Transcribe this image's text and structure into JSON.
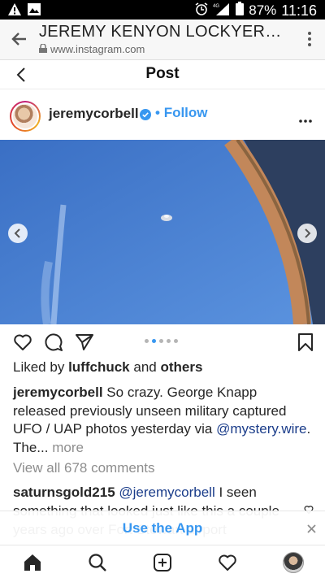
{
  "status_bar": {
    "battery": "87%",
    "time": "11:16",
    "network": "4G"
  },
  "browser": {
    "title": "JEREMY KENYON LOCKYER C...",
    "url": "www.instagram.com"
  },
  "post_header": {
    "title": "Post"
  },
  "author": {
    "username": "jeremycorbell",
    "separator": "•",
    "follow_label": "Follow"
  },
  "carousel": {
    "count": 5,
    "active_index": 1
  },
  "likes": {
    "prefix": "Liked by",
    "user": "luffchuck",
    "middle": "and",
    "suffix": "others"
  },
  "caption": {
    "username": "jeremycorbell",
    "text_1": "So crazy. George Knapp released previously unseen military captured UFO / UAP photos yesterday via",
    "mention": "@mystery.wire",
    "text_2": ". The...",
    "more_label": "more"
  },
  "comments": {
    "view_all": "View all 678 comments",
    "first": {
      "username": "saturnsgold215",
      "mention": "@jeremycorbell",
      "text": "I seen something that looked just like this a couple years ago over Fort Stewart airport"
    }
  },
  "app_banner": {
    "label": "Use the App"
  },
  "colors": {
    "accent": "#3897f0",
    "sky": "#4b84d6"
  }
}
